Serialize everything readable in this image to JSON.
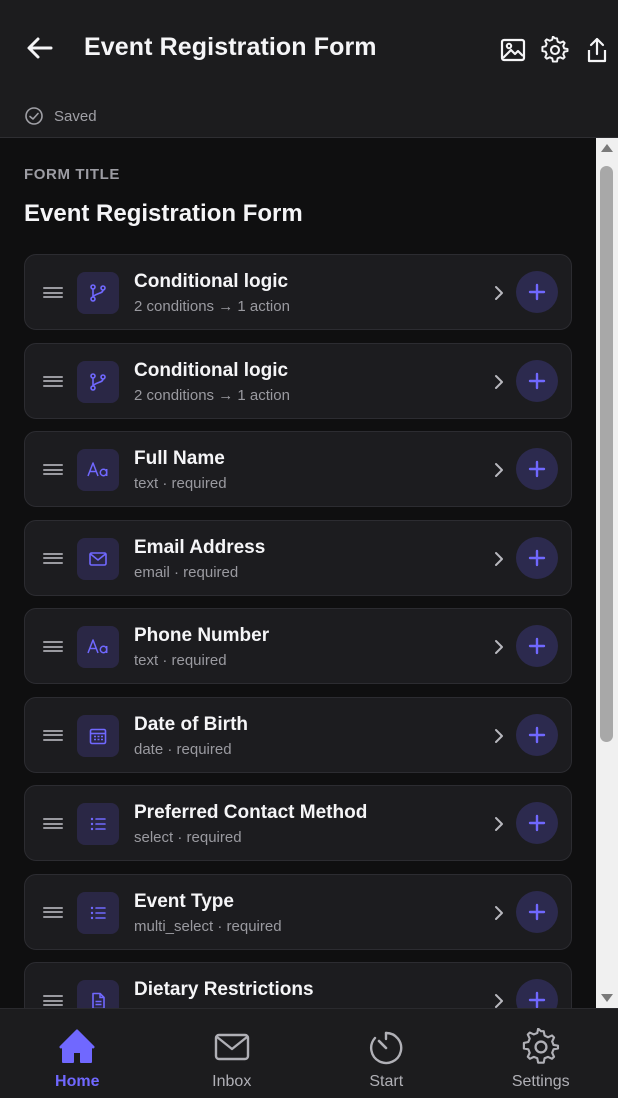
{
  "header": {
    "title": "Event Registration Form",
    "actions": [
      "image-icon",
      "gear-icon",
      "share-icon"
    ]
  },
  "status": {
    "saved_label": "Saved"
  },
  "form": {
    "section_label": "FORM TITLE",
    "title": "Event Registration Form"
  },
  "fields": [
    {
      "name": "Conditional logic",
      "meta": "2 conditions → 1 action",
      "icon": "branch-icon"
    },
    {
      "name": "Conditional logic",
      "meta": "2 conditions → 1 action",
      "icon": "branch-icon"
    },
    {
      "name": "Full Name",
      "meta": "text · required",
      "icon": "text-icon"
    },
    {
      "name": "Email Address",
      "meta": "email · required",
      "icon": "mail-icon"
    },
    {
      "name": "Phone Number",
      "meta": "text · required",
      "icon": "text-icon"
    },
    {
      "name": "Date of Birth",
      "meta": "date · required",
      "icon": "calendar-icon"
    },
    {
      "name": "Preferred Contact Method",
      "meta": "select · required",
      "icon": "list-icon"
    },
    {
      "name": "Event Type",
      "meta": "multi_select · required",
      "icon": "list-icon"
    },
    {
      "name": "Dietary Restrictions",
      "meta": "",
      "icon": "document-icon"
    }
  ],
  "tabs": [
    {
      "label": "Home",
      "icon": "home-icon",
      "active": true
    },
    {
      "label": "Inbox",
      "icon": "inbox-icon",
      "active": false
    },
    {
      "label": "Start",
      "icon": "timer-icon",
      "active": false
    },
    {
      "label": "Settings",
      "icon": "gear-icon",
      "active": false
    }
  ],
  "colors": {
    "accent": "#7068ff",
    "icon_tile": "#2a2745",
    "add_button": "#2c2a4e",
    "surface": "#1c1c1f",
    "background": "#0f0f10"
  }
}
